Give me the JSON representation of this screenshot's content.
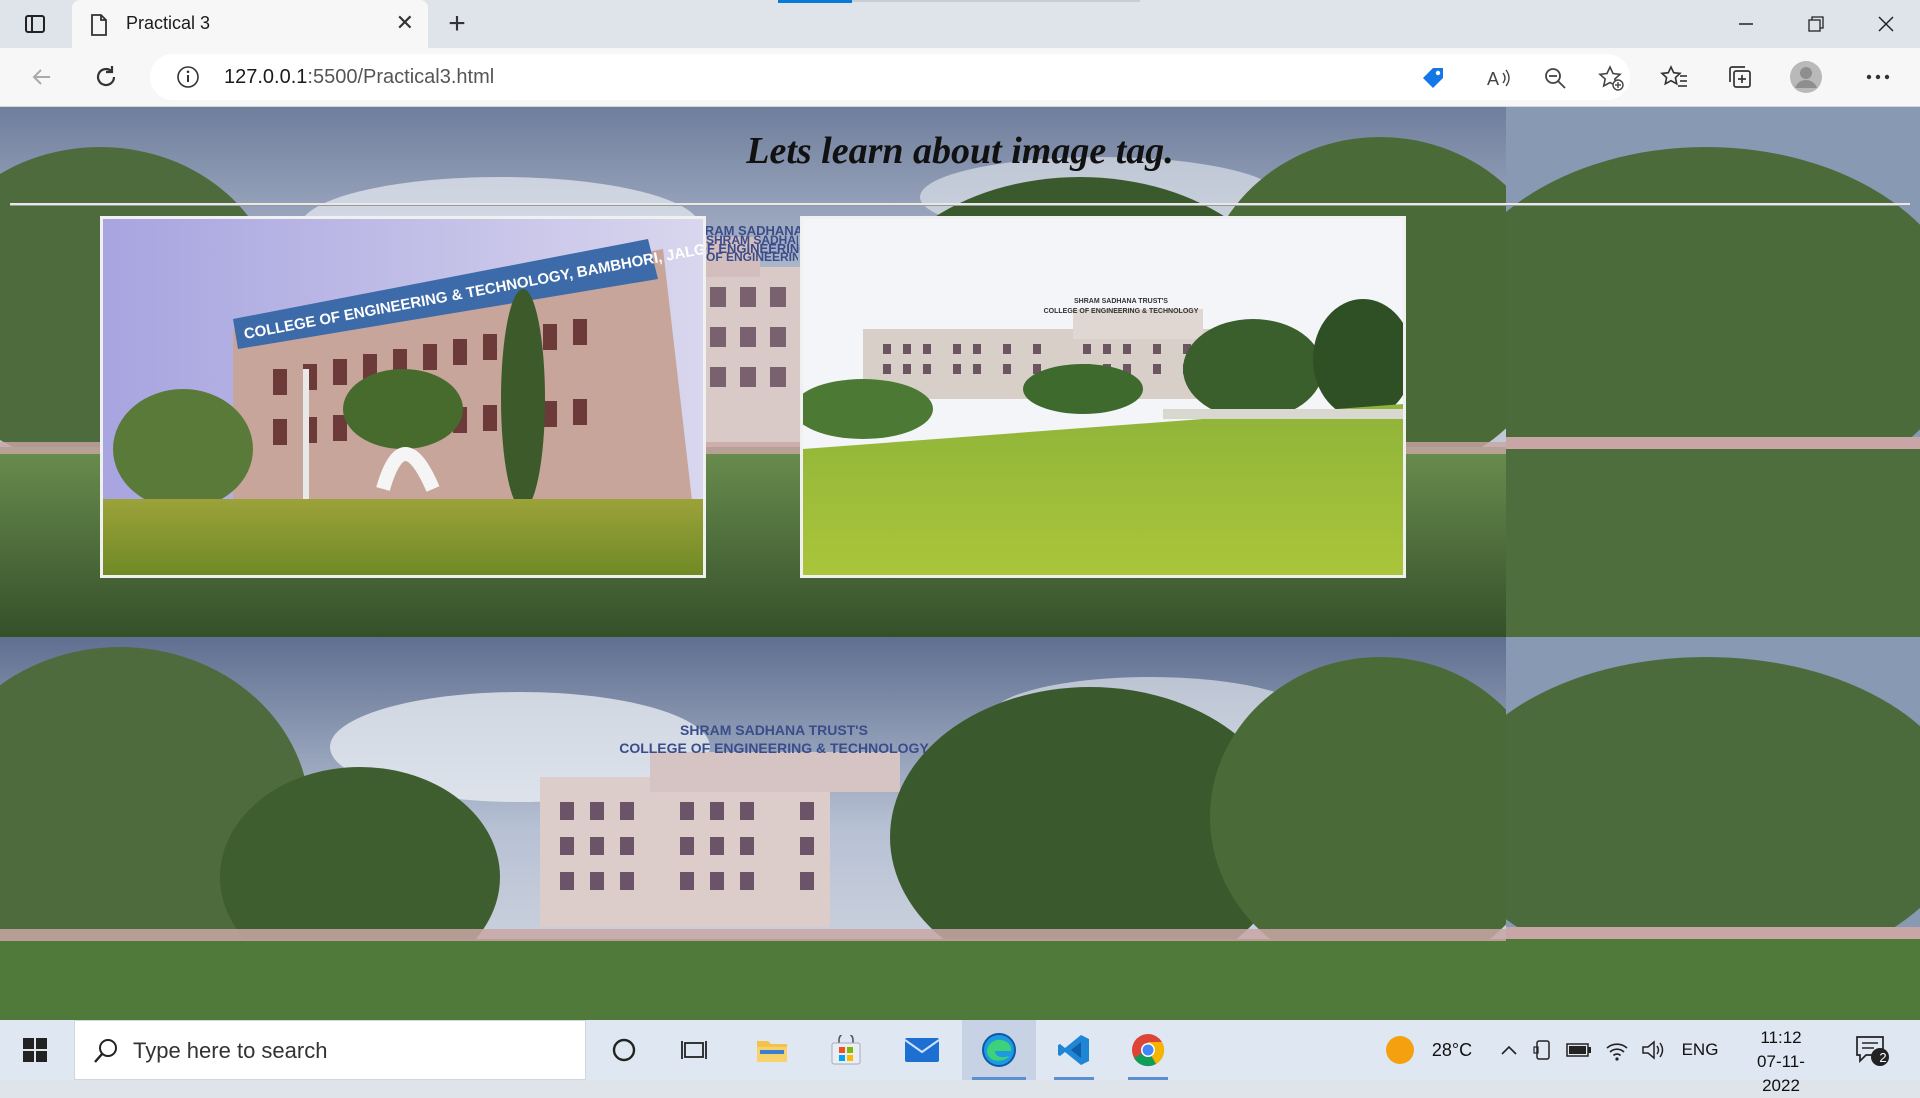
{
  "browser": {
    "tab_title": "Practical 3",
    "url_host": "127.0.0.1",
    "url_path": ":5500/Practical3.html"
  },
  "page": {
    "heading": "Lets learn about image tag.",
    "photo1_sign": "COLLEGE OF ENGINEERING & TECHNOLOGY, BAMBHORI, JALGAON",
    "photo2_sign_top": "SHRAM SADHANA TRUST'S",
    "photo2_sign_bottom": "COLLEGE OF ENGINEERING & TECHNOLOGY",
    "bg_sign_top": "SHRAM SADHANA TRUST'S",
    "bg_sign_bottom": "COLLEGE OF ENGINEERING & TECHNOLOGY",
    "bg_sign_partial_top": "SHRAM SADHANA",
    "bg_sign_partial_bottom": "OF ENGINEERING"
  },
  "taskbar": {
    "search_placeholder": "Type here to search",
    "temperature": "28°C",
    "language": "ENG",
    "time": "11:12",
    "date": "07-11-2022",
    "notification_count": "2"
  },
  "colors": {
    "sky": "#9aa7c0",
    "grass": "#4f7a3a",
    "building": "#d9c9c7",
    "accent": "#0a7ad6"
  }
}
